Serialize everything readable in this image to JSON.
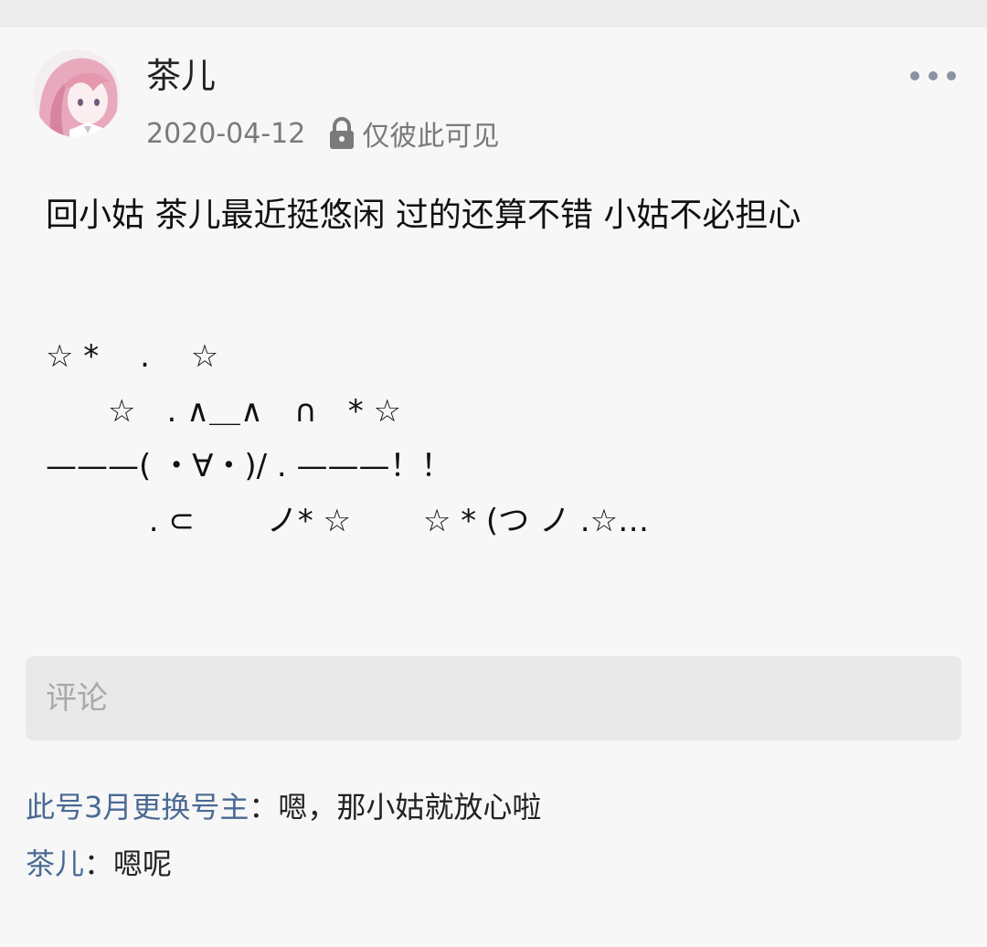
{
  "post": {
    "author": "茶儿",
    "date": "2020-04-12",
    "visibility": "仅彼此可见",
    "text": "回小姑 茶儿最近挺悠闲 过的还算不错 小姑不必担心",
    "art_lines": [
      "☆ *　 .　 ☆",
      "　　☆　. ∧＿∧　∩　* ☆",
      "———( ・∀・)/ . ———！！",
      "　　　 . ⊂　　 ノ* ☆　　 ☆ * (つ ノ .☆…"
    ]
  },
  "comment_input": {
    "placeholder": "评论"
  },
  "comments": [
    {
      "author": "此号3月更换号主",
      "separator": "：",
      "text": "嗯，那小姑就放心啦"
    },
    {
      "author": "茶儿",
      "separator": "：",
      "text": "嗯呢"
    }
  ],
  "icons": {
    "lock": "lock-icon",
    "more": "more-icon",
    "avatar": "avatar"
  },
  "colors": {
    "link": "#4a6a93",
    "meta": "#7a7a7a",
    "background": "#f7f7f7"
  }
}
